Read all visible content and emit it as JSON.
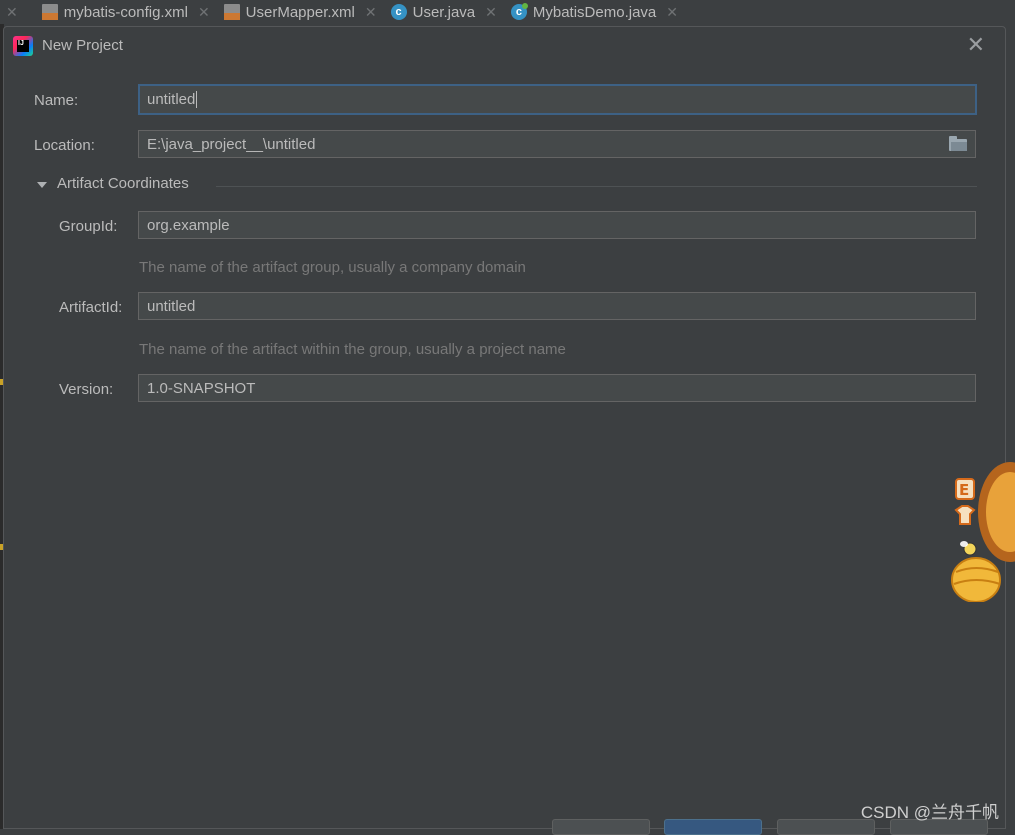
{
  "editor_tabs": [
    {
      "label": "mybatis-config.xml",
      "icon": "xml-file-icon"
    },
    {
      "label": "UserMapper.xml",
      "icon": "xml-file-icon"
    },
    {
      "label": "User.java",
      "icon": "java-class-icon"
    },
    {
      "label": "MybatisDemo.java",
      "icon": "java-class-icon"
    }
  ],
  "dialog": {
    "title": "New Project",
    "name_label": "Name:",
    "name_value": "untitled",
    "location_label": "Location:",
    "location_value": "E:\\java_project__\\untitled",
    "artifact_section": "Artifact Coordinates",
    "groupid_label": "GroupId:",
    "groupid_value": "org.example",
    "groupid_hint": "The name of the artifact group, usually a company domain",
    "artifactid_label": "ArtifactId:",
    "artifactid_value": "untitled",
    "artifactid_hint": "The name of the artifact within the group, usually a project name",
    "version_label": "Version:",
    "version_value": "1.0-SNAPSHOT"
  },
  "watermark": "CSDN @兰舟千帆",
  "colors": {
    "background": "#3c3f41",
    "field_bg": "#45494a",
    "focus_border": "#3d6185",
    "text": "#bbbbbb",
    "hint": "#787878"
  }
}
